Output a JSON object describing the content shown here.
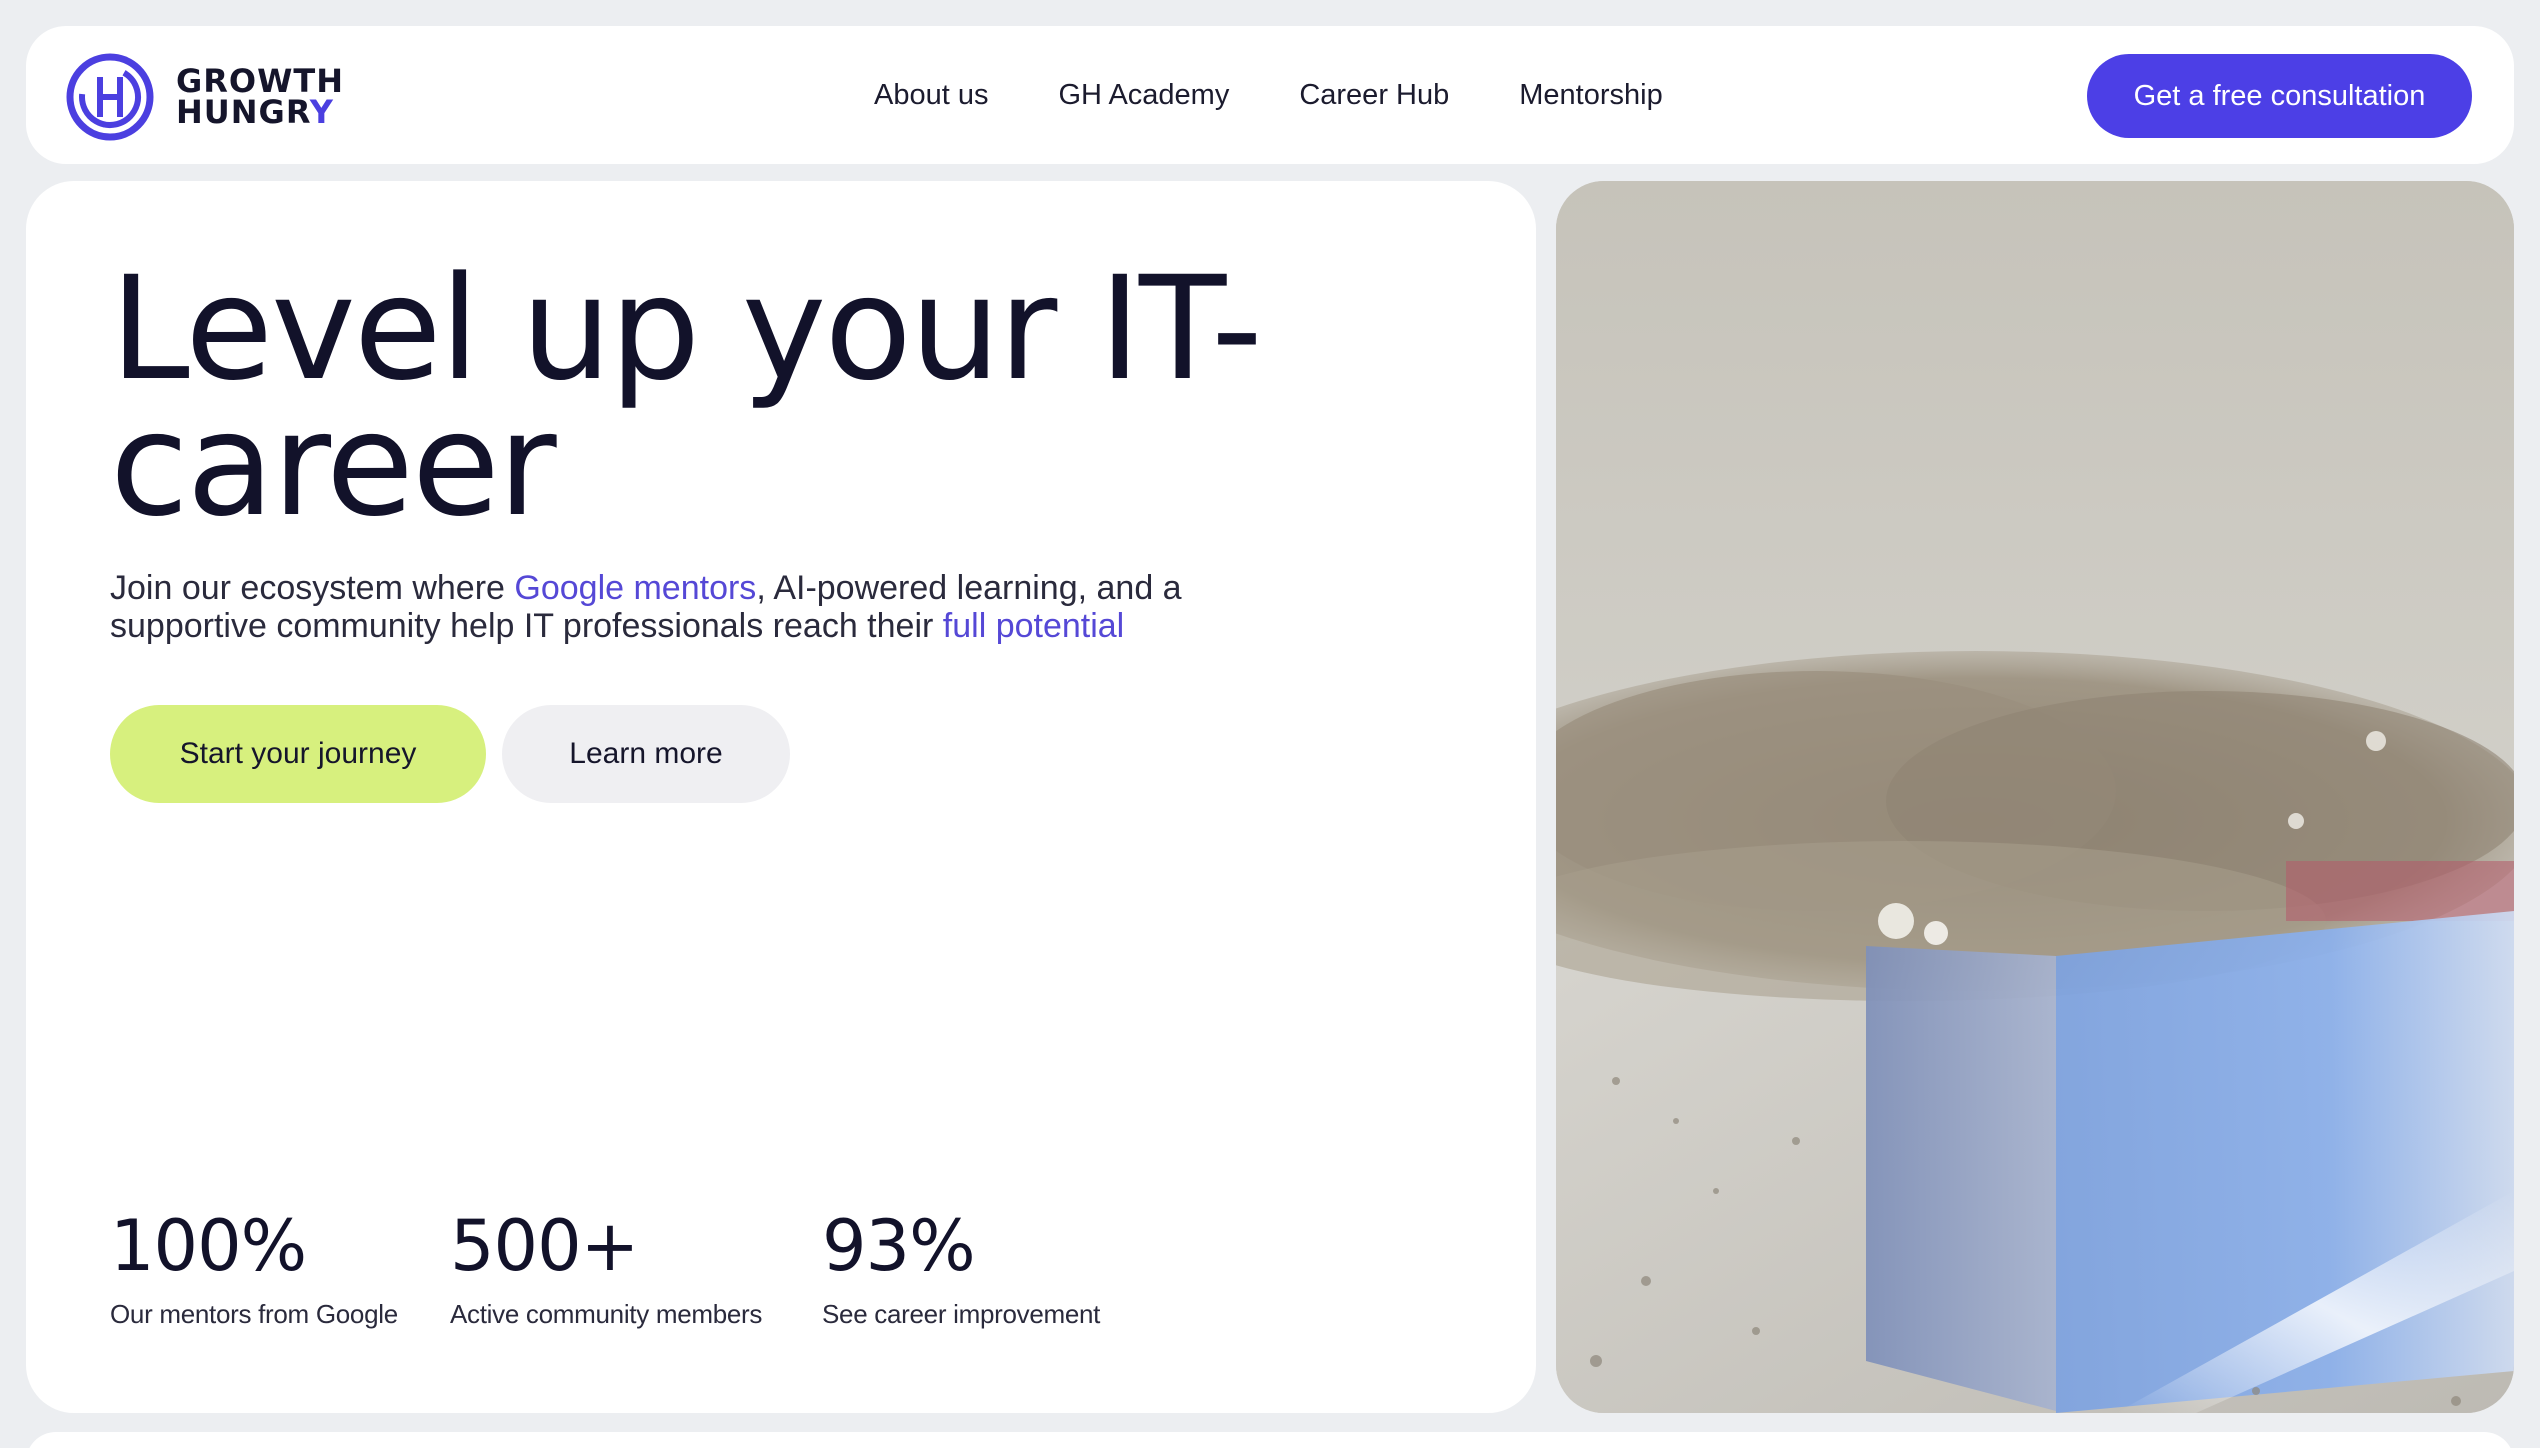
{
  "brand": {
    "line1": "GROWTH",
    "line2_main": "HUNGR",
    "line2_accent": "Y",
    "accent_color": "#4b3fe0"
  },
  "nav": {
    "links": [
      "About us",
      "GH Academy",
      "Career Hub",
      "Mentorship"
    ],
    "cta": "Get a free consultation"
  },
  "hero": {
    "title_line1": "Level up your IT-",
    "title_line2": "career",
    "subtitle": {
      "part1": "Join our ecosystem where ",
      "highlight1": "Google mentors",
      "part2": ", AI-powered learning, and a supportive community help IT professionals reach their ",
      "highlight2": "full potential"
    },
    "primary_button": "Start your journey",
    "secondary_button": "Learn more"
  },
  "stats": [
    {
      "value": "100%",
      "label": "Our mentors from Google"
    },
    {
      "value": "500+",
      "label": "Active community members"
    },
    {
      "value": "93%",
      "label": "See career improvement"
    }
  ],
  "colors": {
    "primary": "#4c3fe6",
    "lime": "#d7f07e",
    "highlight_text": "#5548d6"
  }
}
